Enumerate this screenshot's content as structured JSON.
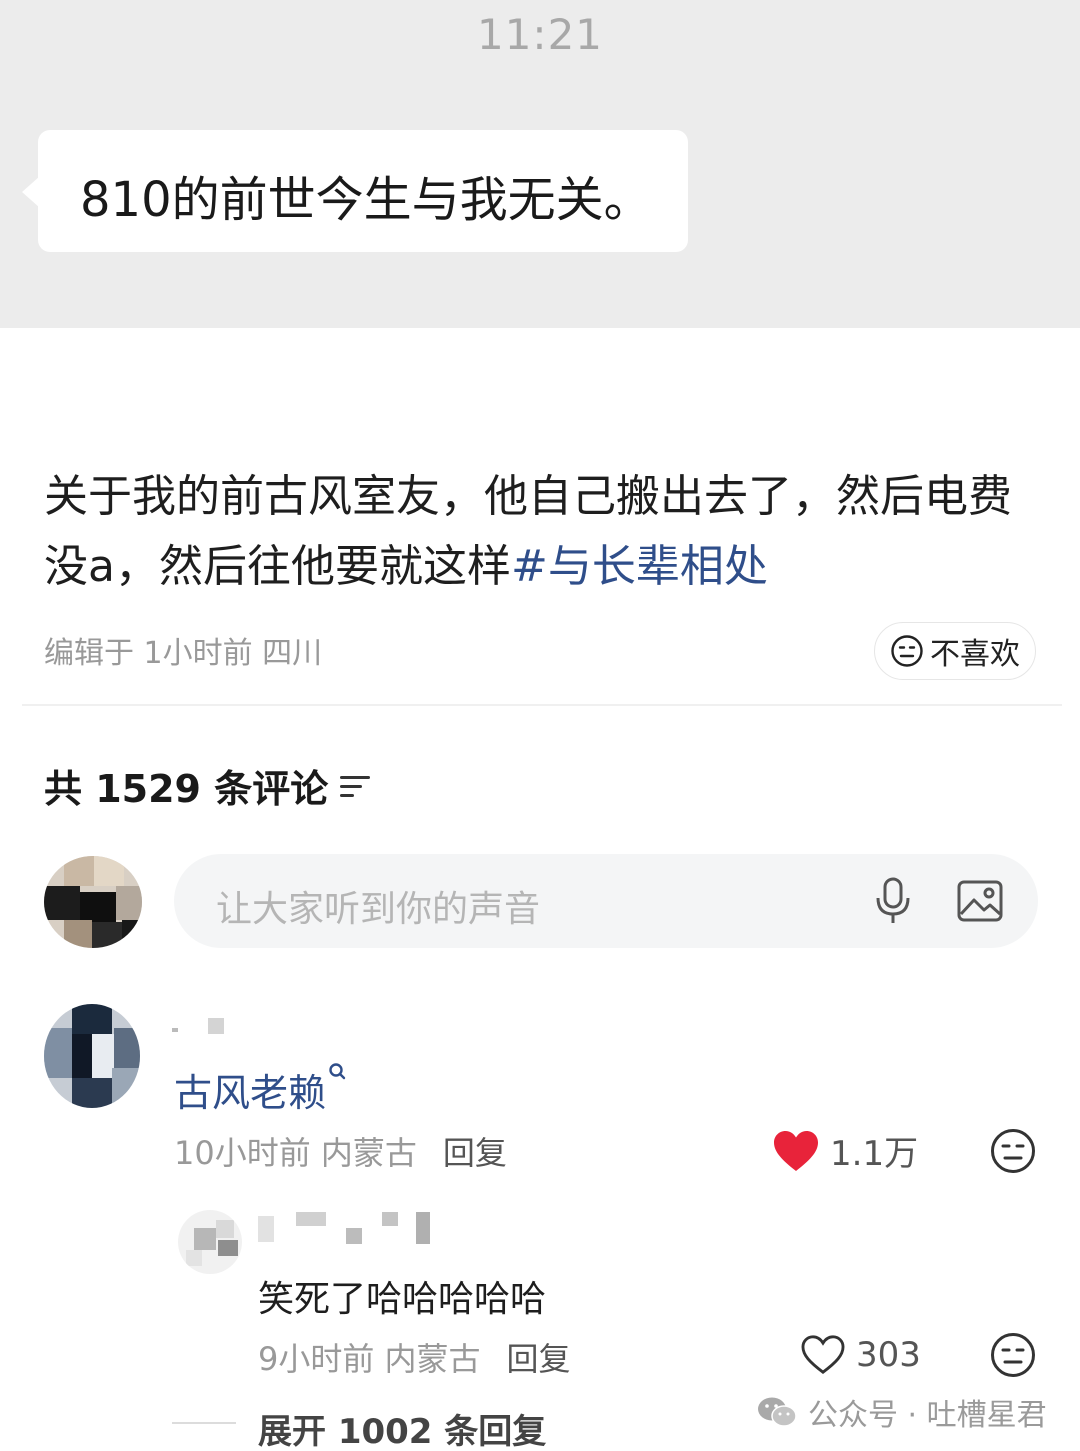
{
  "chat": {
    "time": "11:21",
    "message": "810的前世今生与我无关。"
  },
  "post": {
    "text": "关于我的前古风室友，他自己搬出去了，然后电费没a，然后往他要就这样",
    "hashtag": "#与长辈相处",
    "meta": "编辑于 1小时前 四川",
    "dislike_label": "不喜欢"
  },
  "comments": {
    "header": "共 1529 条评论",
    "input_placeholder": "让大家听到你的声音",
    "items": [
      {
        "text": "古风老赖",
        "time_location": "10小时前 内蒙古",
        "reply_label": "回复",
        "likes": "1.1万",
        "liked": true
      },
      {
        "text": "笑死了哈哈哈哈哈",
        "time_location": "9小时前 内蒙古",
        "reply_label": "回复",
        "likes": "303",
        "liked": false
      }
    ],
    "expand_label": "展开 1002 条回复"
  },
  "watermark": {
    "text": "公众号 · 吐槽星君",
    "icon": "wechat-icon"
  },
  "colors": {
    "chat_bg": "#ececec",
    "hashtag": "#2f4e8a",
    "like_red": "#e8233a",
    "muted": "#999999"
  }
}
